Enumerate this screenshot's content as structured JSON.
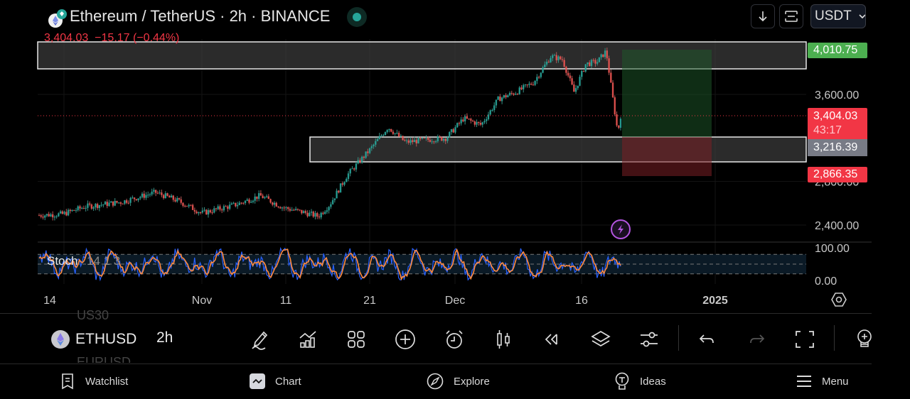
{
  "header": {
    "title": "Ethereum / TetherUS · 2h · BINANCE",
    "last_price": "3,404.03",
    "change": "−15.17 (−0.44%)",
    "currency": "USDT",
    "market_status": "open"
  },
  "icons": {
    "logo": "ethereum-logo-icon",
    "download": "arrow-down-icon",
    "fullscreen": "frame-icon"
  },
  "price_axis": {
    "ticks": [
      {
        "value": 3600,
        "label": "3,600.00"
      },
      {
        "value": 2800,
        "label": "2,800.00"
      },
      {
        "value": 2400,
        "label": "2,400.00"
      }
    ],
    "tags": {
      "take_profit": {
        "label": "4,010.75",
        "value": 4010.75,
        "color": "#4caf50"
      },
      "current": {
        "label": "3,404.03",
        "countdown": "43:17",
        "value": 3404.03,
        "color": "#f23645"
      },
      "entry": {
        "label": "3,216.39",
        "value": 3216.39,
        "color": "#787b86"
      },
      "stop_loss": {
        "label": "2,866.35",
        "value": 2866.35,
        "color": "#f23645"
      }
    }
  },
  "time_axis": {
    "labels": [
      "14",
      "Nov",
      "11",
      "21",
      "Dec",
      "16",
      "2025"
    ]
  },
  "zones": {
    "resistance": {
      "low": 3820,
      "high": 4020
    },
    "support": {
      "low": 3030,
      "high": 3220
    }
  },
  "position": {
    "entry": 3216.39,
    "take_profit": 4010.75,
    "stop_loss": 2866.35
  },
  "stoch": {
    "label": "Stoch",
    "params": "14 1 3",
    "axis_top": "100.00",
    "axis_bottom": "0.00",
    "upper_band": 80,
    "lower_band": 20
  },
  "chart_data": {
    "type": "candlestick",
    "title": "Ethereum / TetherUS · 2h · BINANCE",
    "ylim": [
      2280,
      4080
    ],
    "price_anchors": [
      {
        "t": 0.0,
        "p": 2490
      },
      {
        "t": 0.04,
        "p": 2500
      },
      {
        "t": 0.08,
        "p": 2570
      },
      {
        "t": 0.14,
        "p": 2610
      },
      {
        "t": 0.2,
        "p": 2700
      },
      {
        "t": 0.24,
        "p": 2620
      },
      {
        "t": 0.28,
        "p": 2510
      },
      {
        "t": 0.34,
        "p": 2590
      },
      {
        "t": 0.38,
        "p": 2670
      },
      {
        "t": 0.42,
        "p": 2560
      },
      {
        "t": 0.46,
        "p": 2510
      },
      {
        "t": 0.48,
        "p": 2480
      },
      {
        "t": 0.5,
        "p": 2590
      },
      {
        "t": 0.53,
        "p": 2860
      },
      {
        "t": 0.57,
        "p": 3100
      },
      {
        "t": 0.6,
        "p": 3300
      },
      {
        "t": 0.63,
        "p": 3160
      },
      {
        "t": 0.66,
        "p": 3180
      },
      {
        "t": 0.7,
        "p": 3200
      },
      {
        "t": 0.73,
        "p": 3380
      },
      {
        "t": 0.76,
        "p": 3320
      },
      {
        "t": 0.79,
        "p": 3560
      },
      {
        "t": 0.82,
        "p": 3620
      },
      {
        "t": 0.85,
        "p": 3710
      },
      {
        "t": 0.88,
        "p": 3950
      },
      {
        "t": 0.9,
        "p": 3920
      },
      {
        "t": 0.92,
        "p": 3620
      },
      {
        "t": 0.94,
        "p": 3880
      },
      {
        "t": 0.96,
        "p": 3900
      },
      {
        "t": 0.975,
        "p": 4000
      },
      {
        "t": 0.985,
        "p": 3620
      },
      {
        "t": 0.995,
        "p": 3250
      },
      {
        "t": 1.0,
        "p": 3404
      }
    ],
    "xlabel": "",
    "ylabel": ""
  },
  "toolbar": {
    "symbol_prev": "US30",
    "symbol": "ETHUSD",
    "symbol_next": "EURUSD",
    "interval": "2h",
    "tools": [
      "drawing-tools",
      "indicators",
      "layouts",
      "add",
      "alert",
      "chart-type",
      "replay",
      "object-tree",
      "settings",
      "undo",
      "redo",
      "fullscreen",
      "ideas"
    ]
  },
  "nav": {
    "items": [
      {
        "label": "Watchlist",
        "icon": "watchlist-icon"
      },
      {
        "label": "Chart",
        "icon": "chart-icon"
      },
      {
        "label": "Explore",
        "icon": "compass-icon"
      },
      {
        "label": "Ideas",
        "icon": "lightbulb-icon"
      },
      {
        "label": "Menu",
        "icon": "menu-icon"
      }
    ]
  }
}
